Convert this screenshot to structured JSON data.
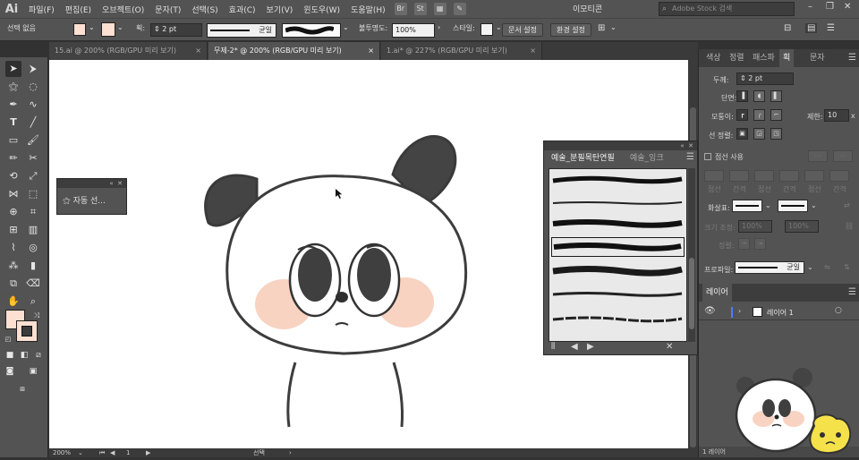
{
  "app": {
    "logo": "Ai"
  },
  "menubar": {
    "items": [
      "파일(F)",
      "편집(E)",
      "오브젝트(O)",
      "문자(T)",
      "선택(S)",
      "효과(C)",
      "보기(V)",
      "윈도우(W)",
      "도움말(H)"
    ],
    "br_icon": "Br",
    "st_icon": "St",
    "workspace": "이모티콘",
    "search_placeholder": "Adobe Stock 검색"
  },
  "controlbar": {
    "selection": "선택 없음",
    "stroke_label": "획:",
    "stroke_weight": "2 pt",
    "stroke_profile": "균일",
    "opacity_label": "불투명도:",
    "opacity": "100%",
    "style_label": "스타일:",
    "doc_setup": "문서 설정",
    "preferences": "환경 설정",
    "fill_color": "#fde0d2"
  },
  "tabs": [
    {
      "label": "15.ai @ 200% (RGB/GPU 미리 보기)",
      "active": false
    },
    {
      "label": "무제-2* @ 200% (RGB/GPU 미리 보기)",
      "active": true
    },
    {
      "label": "1.ai* @ 227% (RGB/GPU 미리 보기)",
      "active": false
    }
  ],
  "status": {
    "zoom": "200%",
    "artboard": "1",
    "tool": "선택"
  },
  "auto_select_panel": {
    "label": "자동 선..."
  },
  "brush_panel": {
    "tabs": [
      "예술_분필목탄연필",
      "예술_잉크"
    ],
    "brush_count": 7,
    "selected_index": 3
  },
  "right_panel": {
    "tabs": [
      "색상",
      "정렬",
      "패스파",
      "획",
      "문자"
    ],
    "stroke": {
      "weight_label": "두께:",
      "weight": "2 pt",
      "cap_label": "단면:",
      "corner_label": "모퉁이:",
      "limit_label": "제한:",
      "limit": "10",
      "align_label": "선 정렬:",
      "dashed_label": "점선 사용",
      "dash_labels": [
        "점선",
        "간격",
        "점선",
        "간격",
        "점선",
        "간격"
      ],
      "arrow_label": "화살표:",
      "scale_label": "크기 조정:",
      "scale_a": "100%",
      "scale_b": "100%",
      "align_arrow_label": "정렬:",
      "profile_label": "프로파일:",
      "profile": "균일"
    },
    "layers": {
      "tab": "레이어",
      "layer_name": "레이어 1",
      "footer": "1 레이어"
    }
  },
  "colors": {
    "panel": "#535353",
    "dark": "#323232",
    "canvas": "#ffffff",
    "cheek": "#f8d3c2",
    "outline": "#3a3a3a",
    "layer_color": "#4f7cff"
  }
}
